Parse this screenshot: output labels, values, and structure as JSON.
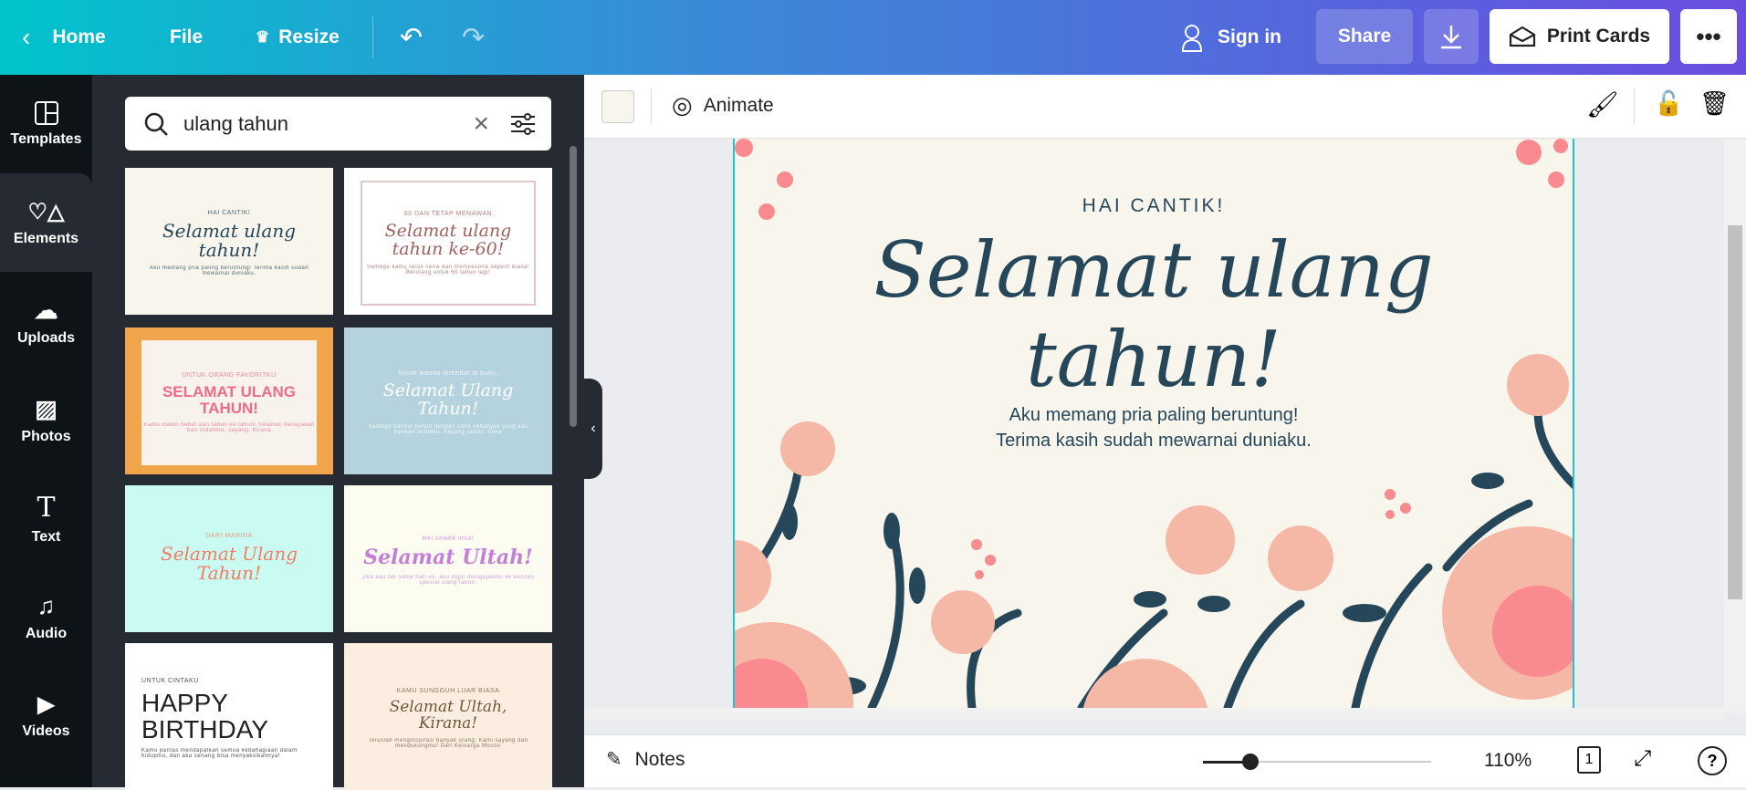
{
  "topbar": {
    "home": "Home",
    "file": "File",
    "resize": "Resize",
    "sign_in": "Sign in",
    "share": "Share",
    "print": "Print Cards"
  },
  "rail": [
    {
      "label": "Templates",
      "icon": "templates-icon"
    },
    {
      "label": "Elements",
      "icon": "elements-icon"
    },
    {
      "label": "Uploads",
      "icon": "upload-icon"
    },
    {
      "label": "Photos",
      "icon": "photos-icon"
    },
    {
      "label": "Text",
      "icon": "text-icon"
    },
    {
      "label": "Audio",
      "icon": "audio-icon"
    },
    {
      "label": "Videos",
      "icon": "video-icon"
    }
  ],
  "search": {
    "value": "ulang tahun"
  },
  "templates": [
    {
      "small": "HAI CANTIK!",
      "title": "Selamat ulang tahun!",
      "body": "Aku memang pria paling beruntung! Terima kasih sudah mewarnai duniaku."
    },
    {
      "small": "60 DAN TETAP MENAWAN",
      "title": "Selamat ulang tahun ke-60!",
      "body": "Semoga kamu terus ceria dan mempesona seperti biasa! Berulang untuk 60 tahun lagi!"
    },
    {
      "small": "UNTUK ORANG FAVORITKU",
      "title": "SELAMAT ULANG TAHUN!",
      "body": "Kamu makin hebat dari tahun ke tahun! Selamat merayakan hari indahmu, sayang. Kirana"
    },
    {
      "small": "Untuk wanita terhebat di bumi,",
      "title": "Selamat Ulang Tahun!",
      "body": "Semoga harimu penuh dengan cinta sebanyak yang kau berikan untukku. Sayang selalu, Anna"
    },
    {
      "small": "DARI MARINA",
      "title": "Selamat Ulang Tahun!",
      "body": ""
    },
    {
      "small": "Hei cewek imut!",
      "title": "Selamat Ultah!",
      "body": "Jika kau tak sibuk hari ini, aku ingin mengajakmu ke kencan spesial ulang tahun."
    },
    {
      "small": "UNTUK CINTAKU",
      "title": "HAPPY BIRTHDAY",
      "body": "Kamu pantas mendapatkan semua kebahagiaan dalam hidupmu, dan aku senang bisa menyaksikannya!"
    },
    {
      "small": "KAMU SUNGGUH LUAR BIASA",
      "title": "Selamat Ultah, Kirana!",
      "body": "Teruslah menginspirasi banyak orang. Kami sayang dan mendukungmu! Dari Keluarga Mosori"
    }
  ],
  "toolbar": {
    "animate": "Animate",
    "swatch": "#f8f5ec"
  },
  "design": {
    "small": "HAI CANTIK!",
    "title": "Selamat ulang tahun!",
    "line1": "Aku memang pria paling beruntung!",
    "line2": "Terima kasih sudah mewarnai duniaku."
  },
  "bottombar": {
    "notes": "Notes",
    "zoom": "110%",
    "page": "1",
    "zoom_percent": 110
  }
}
